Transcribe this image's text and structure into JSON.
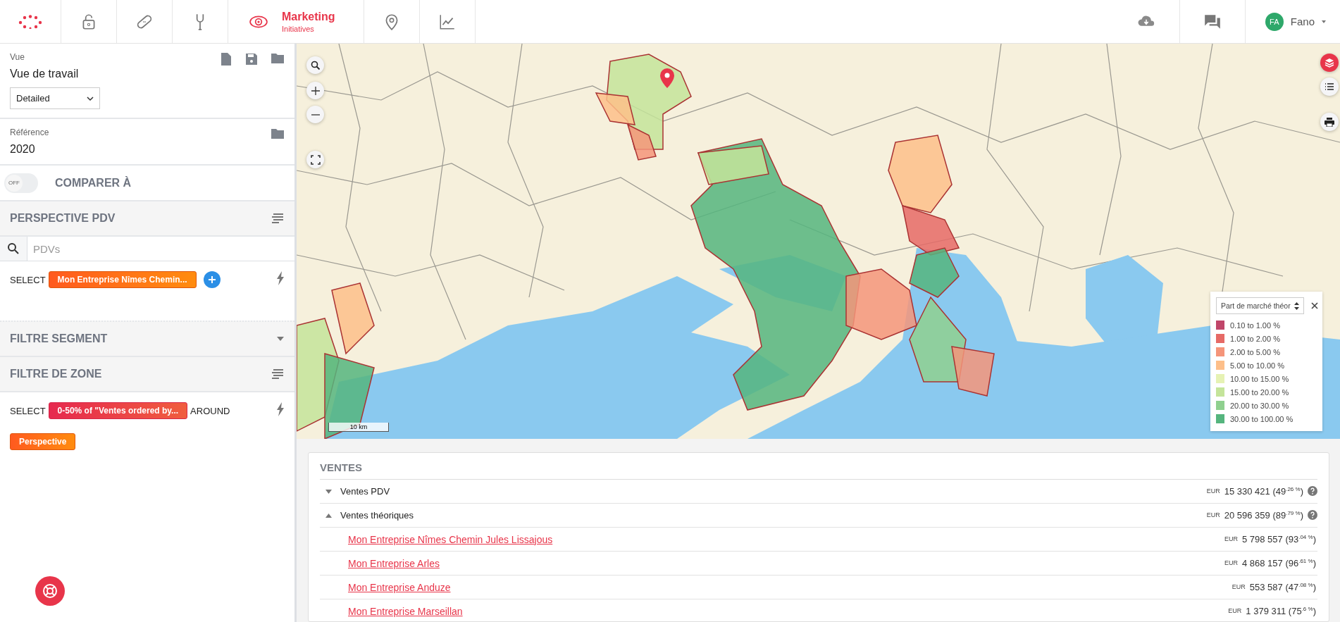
{
  "topbar": {
    "nav": [
      {
        "kind": "lock",
        "selected": false
      },
      {
        "kind": "bandage",
        "selected": false
      },
      {
        "kind": "wrench",
        "selected": false
      },
      {
        "kind": "eye",
        "label": "Marketing",
        "sublabel": "Initiatives",
        "selected": true
      },
      {
        "kind": "pin",
        "selected": false
      },
      {
        "kind": "chart",
        "selected": false
      }
    ],
    "user": {
      "initials": "FA",
      "name": "Fano"
    }
  },
  "sidebar": {
    "view": {
      "label": "Vue",
      "value": "Vue de travail",
      "select": "Detailed"
    },
    "reference": {
      "label": "Référence",
      "value": "2020"
    },
    "compare": {
      "toggle_text": "OFF",
      "on": false,
      "label": "COMPARER À"
    },
    "perspective": {
      "title": "PERSPECTIVE PDV",
      "placeholder": "PDVs",
      "select_label": "SELECT",
      "chip": "Mon Entreprise Nîmes Chemin..."
    },
    "segment": {
      "title": "FILTRE SEGMENT",
      "expanded": false
    },
    "zone": {
      "title": "FILTRE DE ZONE",
      "select_label": "SELECT",
      "chip": "0-50% of \"Ventes ordered by...",
      "around_label": "AROUND",
      "chip2": "Perspective"
    }
  },
  "map": {
    "scale": "10 km",
    "legend": {
      "select": "Part de marché théor",
      "items": [
        {
          "label": "0.10 to 1.00 %",
          "color": "#c0466a"
        },
        {
          "label": "1.00 to 2.00 %",
          "color": "#e66a66"
        },
        {
          "label": "2.00 to 5.00 %",
          "color": "#f5957a"
        },
        {
          "label": "5.00 to 10.00 %",
          "color": "#fdbf8a"
        },
        {
          "label": "10.00 to 15.00 %",
          "color": "#e6f2b4"
        },
        {
          "label": "15.00 to 20.00 %",
          "color": "#c4e49a"
        },
        {
          "label": "20.00 to 30.00 %",
          "color": "#8fd08f"
        },
        {
          "label": "30.00 to 100.00 %",
          "color": "#55b57e"
        }
      ]
    }
  },
  "sales": {
    "title": "VENTES",
    "rows": [
      {
        "label": "Ventes PDV",
        "currency": "EUR",
        "value": "15 330 421 (49$^{.26 %}$)",
        "expanded": false
      },
      {
        "label": "Ventes théoriques",
        "currency": "EUR",
        "value": "20 596 359 (89$^{.79 %}$)",
        "expanded": true,
        "children": [
          {
            "label": "Mon Entreprise Nîmes Chemin Jules Lissajous",
            "currency": "EUR",
            "value": "5 798 557 (93$^{.04 %}$)"
          },
          {
            "label": "Mon Entreprise Arles",
            "currency": "EUR",
            "value": "4 868 157 (96$^{.61 %}$)"
          },
          {
            "label": "Mon Entreprise Anduze",
            "currency": "EUR",
            "value": "553 587 (47$^{.08 %}$)"
          },
          {
            "label": "Mon Entreprise Marseillan",
            "currency": "EUR",
            "value": "1 379 311 (75$^{.6 %}$)"
          }
        ]
      }
    ]
  }
}
